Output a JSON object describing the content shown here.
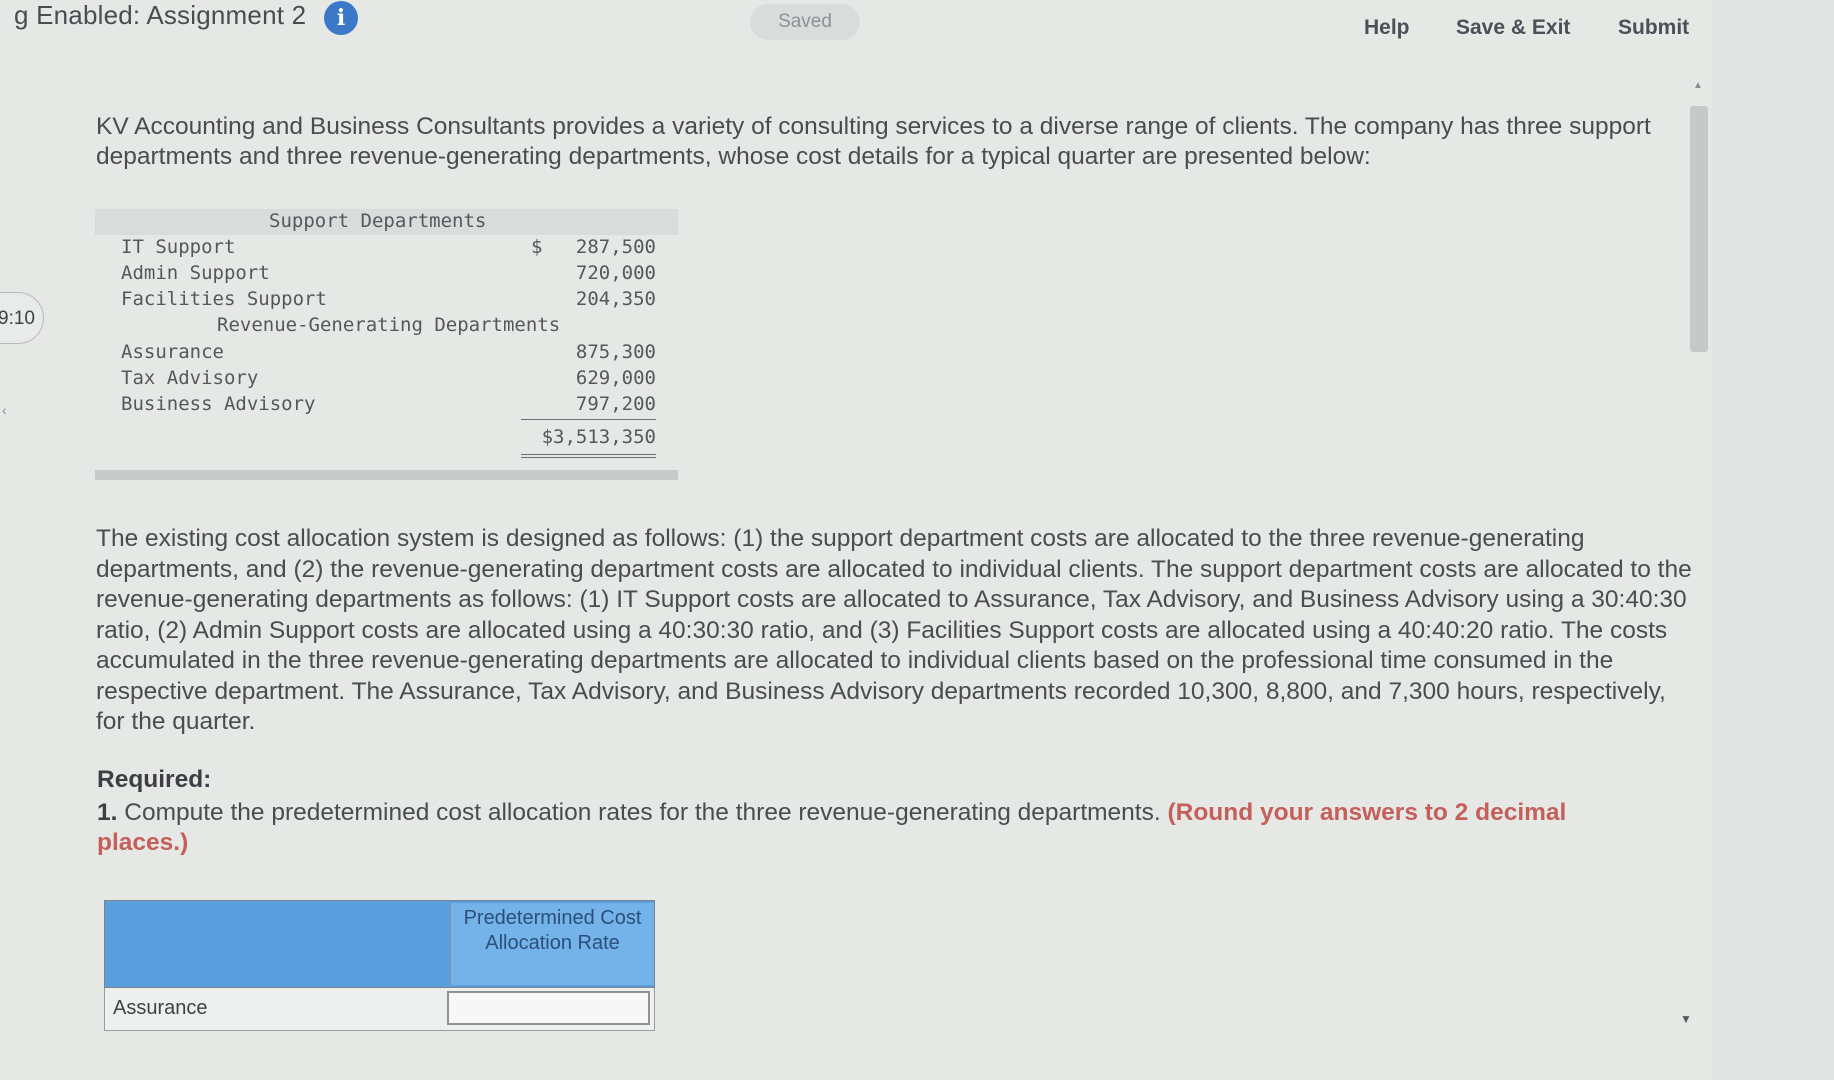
{
  "header": {
    "assignment_title": "g Enabled: Assignment 2",
    "info_icon": "info-icon",
    "saved_status": "Saved",
    "help_label": "Help",
    "save_exit_label": "Save & Exit",
    "submit_label": "Submit"
  },
  "sidebar": {
    "timer": "9:10",
    "collapse_glyph": "‹"
  },
  "intro_text": "KV Accounting and Business Consultants provides a variety of consulting services to a diverse range of clients. The company has three support departments and three revenue-generating departments, whose cost details for a typical quarter are presented below:",
  "cost_table": {
    "support_header": "Support Departments",
    "revenue_header": "Revenue-Generating Departments",
    "currency_symbol": "$",
    "support_rows": [
      {
        "label": "IT Support",
        "value": "287,500"
      },
      {
        "label": "Admin Support",
        "value": "720,000"
      },
      {
        "label": "Facilities Support",
        "value": "204,350"
      }
    ],
    "revenue_rows": [
      {
        "label": "Assurance",
        "value": "875,300"
      },
      {
        "label": "Tax Advisory",
        "value": "629,000"
      },
      {
        "label": "Business Advisory",
        "value": "797,200"
      }
    ],
    "total": "$3,513,350"
  },
  "description_text": "The existing cost allocation system is designed as follows: (1) the support department costs are allocated to the three revenue-generating departments, and (2) the revenue-generating department costs are allocated to individual clients. The support department costs are allocated to the revenue-generating departments as follows: (1) IT Support costs are allocated to Assurance, Tax Advisory, and Business Advisory using a 30:40:30 ratio, (2) Admin Support costs are allocated using a 40:30:30 ratio, and (3) Facilities Support costs are allocated using a 40:40:20 ratio. The costs accumulated in the three revenue-generating departments are allocated to individual clients based on the professional time consumed in the respective department. The Assurance, Tax Advisory, and Business Advisory departments recorded 10,300, 8,800, and 7,300 hours, respectively, for the quarter.",
  "required": {
    "label": "Required:",
    "number": "1.",
    "question": "Compute the predetermined cost allocation rates for the three revenue-generating departments.",
    "round_note": "(Round your answers to 2 decimal places.)"
  },
  "answer_table": {
    "column_header": "Predetermined Cost Allocation Rate",
    "rows": [
      {
        "label": "Assurance",
        "value": ""
      }
    ]
  },
  "scrollbar": {
    "up_glyph": "▲",
    "down_glyph": "▼"
  }
}
